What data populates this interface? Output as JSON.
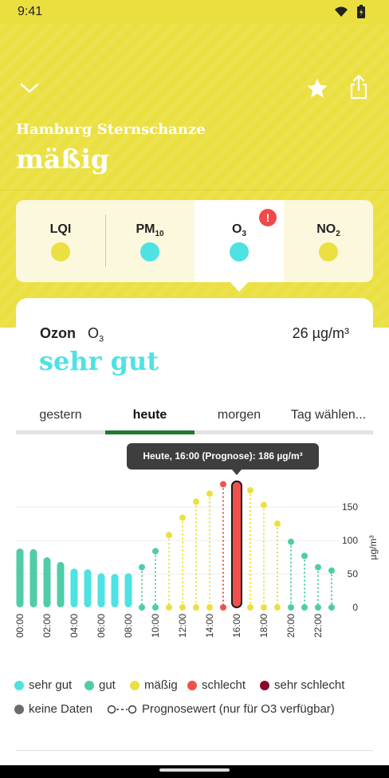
{
  "status": {
    "time": "9:41"
  },
  "station": {
    "name": "Hamburg Sternschanze",
    "quality": "mäßig"
  },
  "pollutant_tabs": [
    {
      "label": "LQI",
      "sub": "",
      "dot_color": "#ebe041"
    },
    {
      "label": "PM",
      "sub": "10",
      "dot_color": "#4ee2e2"
    },
    {
      "label": "O",
      "sub": "3",
      "dot_color": "#4ee2e2",
      "alert": "!"
    },
    {
      "label": "NO",
      "sub": "2",
      "dot_color": "#ebe041"
    }
  ],
  "detail": {
    "name": "Ozon",
    "formula": "O",
    "formula_sub": "3",
    "value": "26 µg/m³",
    "rating": "sehr gut"
  },
  "day_tabs": [
    "gestern",
    "heute",
    "morgen",
    "Tag wählen..."
  ],
  "tooltip": "Heute, 16:00 (Prognose): 186 µg/m³",
  "chart_data": {
    "type": "bar",
    "title": "",
    "ylabel": "µg/m³",
    "ylim": [
      0,
      200
    ],
    "yticks": [
      "0",
      "50",
      "100",
      "150"
    ],
    "categories": [
      "00:00",
      "01:00",
      "02:00",
      "03:00",
      "04:00",
      "05:00",
      "06:00",
      "07:00",
      "08:00",
      "09:00",
      "10:00",
      "11:00",
      "12:00",
      "13:00",
      "14:00",
      "15:00",
      "16:00",
      "17:00",
      "18:00",
      "19:00",
      "20:00",
      "21:00",
      "22:00",
      "23:00"
    ],
    "xticks": [
      "00:00",
      "02:00",
      "04:00",
      "06:00",
      "08:00",
      "10:00",
      "12:00",
      "14:00",
      "16:00",
      "18:00",
      "20:00",
      "22:00"
    ],
    "measured": [
      88,
      87,
      75,
      68,
      58,
      57,
      51,
      50,
      51
    ],
    "forecast": [
      null,
      null,
      null,
      null,
      null,
      null,
      null,
      null,
      null,
      60,
      84,
      108,
      134,
      158,
      170,
      184,
      186,
      175,
      153,
      125,
      98,
      77,
      60,
      55
    ],
    "selected_index": 16,
    "colors": {
      "sehr gut": "#4ee2e2",
      "gut": "#50cca8",
      "mäßig": "#ebe041",
      "schlecht": "#f2504d",
      "sehr schlecht": "#8b0a2a",
      "keine Daten": "#6b6b6b"
    }
  },
  "legend": {
    "items": [
      {
        "label": "sehr gut",
        "color": "#4ee2e2"
      },
      {
        "label": "gut",
        "color": "#50cca8"
      },
      {
        "label": "mäßig",
        "color": "#ebe041"
      },
      {
        "label": "schlecht",
        "color": "#f2504d"
      },
      {
        "label": "sehr schlecht",
        "color": "#8b0a2a"
      },
      {
        "label": "keine Daten",
        "color": "#6b6b6b"
      }
    ],
    "forecast_label": "Prognosewert (nur für O3 verfügbar)"
  }
}
